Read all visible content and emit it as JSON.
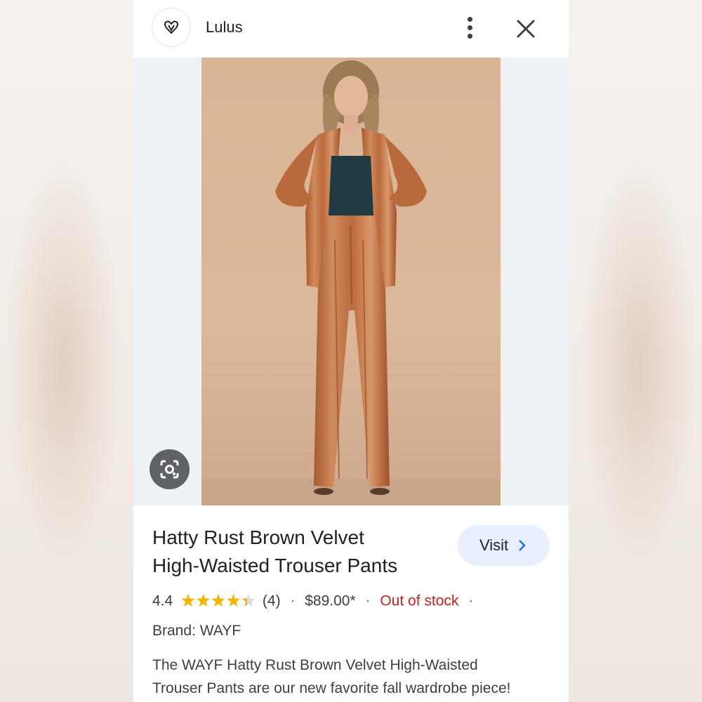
{
  "header": {
    "site_name": "Lulus",
    "logo_icon": "heart-logo-icon",
    "more_icon": "more-vert-icon",
    "close_icon": "close-icon"
  },
  "image": {
    "lens_icon": "google-lens-icon"
  },
  "product": {
    "title_line1": "Hatty Rust Brown Velvet",
    "title_line2": "High-Waisted Trouser Pants",
    "visit_label": "Visit",
    "rating": "4.4",
    "rating_value": 4.4,
    "rating_max": 5,
    "review_count": "(4)",
    "price": "$89.00*",
    "stock_status": "Out of stock",
    "brand": "Brand: WAYF",
    "description_line1": "The WAYF Hatty Rust Brown Velvet High-Waisted",
    "description_line2": "Trouser Pants are our new favorite fall wardrobe piece!"
  },
  "colors": {
    "star": "#f4b400",
    "star_empty": "#dadce0",
    "out_of_stock": "#c5221f",
    "visit_bg": "#e8f0fe",
    "visit_chevron": "#1a73e8"
  }
}
